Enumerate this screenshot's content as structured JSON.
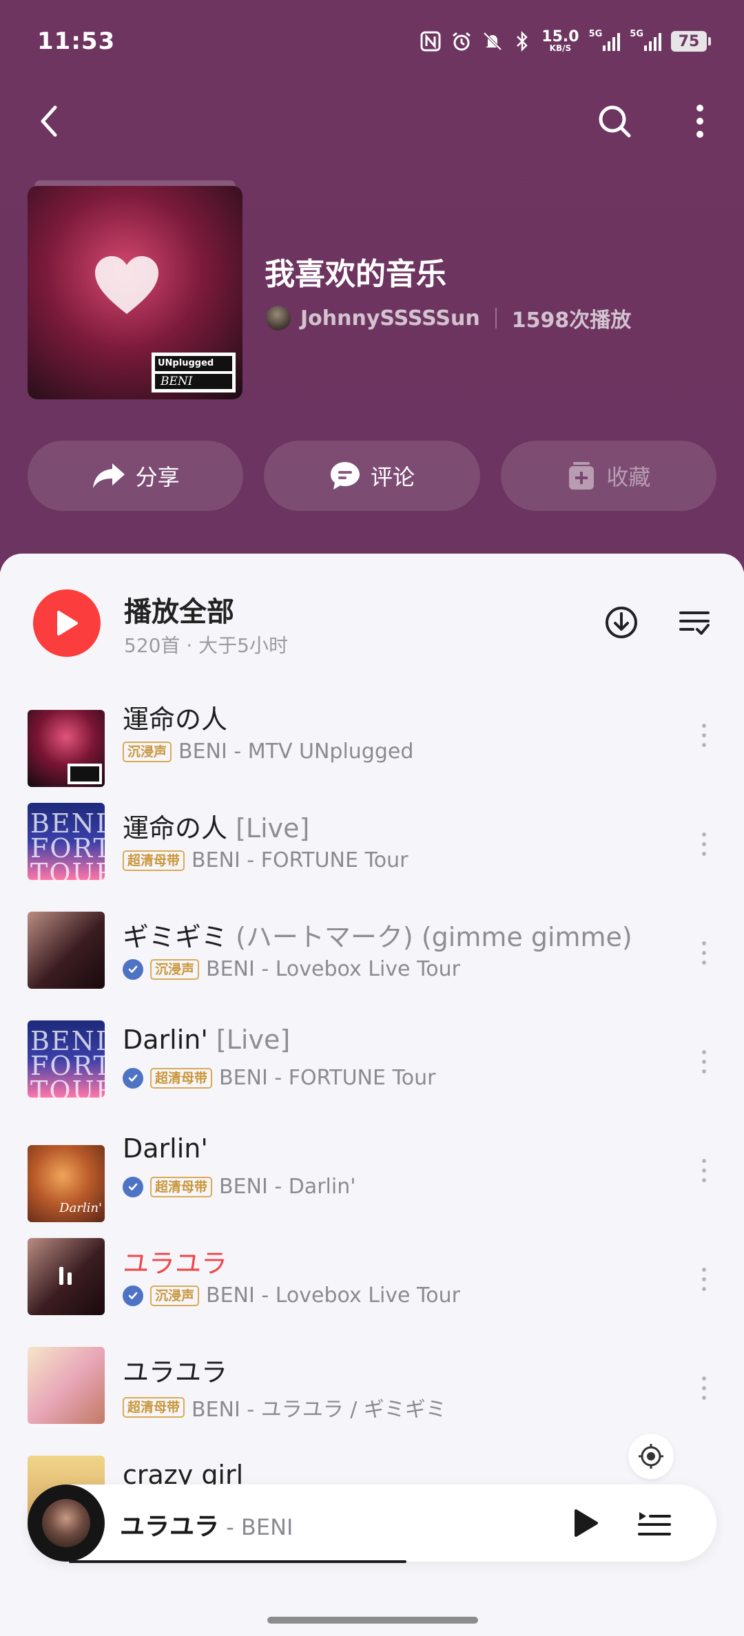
{
  "status_bar": {
    "time": "11:53",
    "net_speed_value": "15.0",
    "net_speed_unit": "KB/S",
    "battery": "75",
    "signal_1": "5G",
    "signal_2": "5G"
  },
  "playlist": {
    "title": "我喜欢的音乐",
    "owner": "JohnnySSSSSun",
    "play_count": "1598次播放",
    "cover_label_top": "UNplugged",
    "cover_label_bottom": "BENI"
  },
  "actions": {
    "share": "分享",
    "comment": "评论",
    "collect": "收藏"
  },
  "play_all": {
    "title": "播放全部",
    "subtitle": "520首 · 大于5小时"
  },
  "songs": [
    {
      "title": "運命の人",
      "suffix": "",
      "verified": false,
      "quality": "沉浸声",
      "artist_album": "BENI - MTV UNplugged",
      "playing": false
    },
    {
      "title": "運命の人",
      "suffix": " [Live]",
      "verified": false,
      "quality": "超清母带",
      "artist_album": "BENI - FORTUNE Tour",
      "playing": false,
      "art_text": "BENI FORTUNE TOUR"
    },
    {
      "title": "ギミギミ",
      "suffix": " (ハートマーク) (gimme gimme)",
      "verified": true,
      "quality": "沉浸声",
      "artist_album": "BENI - Lovebox Live Tour",
      "playing": false
    },
    {
      "title": "Darlin'",
      "suffix": " [Live]",
      "verified": true,
      "quality": "超清母带",
      "artist_album": "BENI - FORTUNE Tour",
      "playing": false,
      "art_text": "BENI FORTUNE TOUR"
    },
    {
      "title": "Darlin'",
      "suffix": "",
      "verified": true,
      "quality": "超清母带",
      "artist_album": "BENI - Darlin'",
      "playing": false
    },
    {
      "title": "ユラユラ",
      "suffix": "",
      "verified": true,
      "quality": "沉浸声",
      "artist_album": "BENI - Lovebox Live Tour",
      "playing": true
    },
    {
      "title": "ユラユラ",
      "suffix": "",
      "verified": false,
      "quality": "超清母带",
      "artist_album": "BENI - ユラユラ / ギミギミ",
      "playing": false
    },
    {
      "title": "crazy girl",
      "suffix": "",
      "verified": false,
      "quality": "",
      "artist_album": "",
      "playing": false
    }
  ],
  "mini_player": {
    "title": "ユラユラ",
    "artist": " - BENI",
    "progress": 0.49
  },
  "colors": {
    "header_bg": "#6e3560",
    "accent_red": "#fc3d3d",
    "playing_text": "#f0464a",
    "verified_blue": "#4f73c4",
    "quality_gold": "#c9963a"
  },
  "icons": [
    "back-icon",
    "search-icon",
    "more-vertical-icon",
    "share-icon",
    "comment-icon",
    "collect-icon",
    "play-icon",
    "download-icon",
    "multi-select-icon",
    "locate-icon",
    "playlist-icon"
  ]
}
